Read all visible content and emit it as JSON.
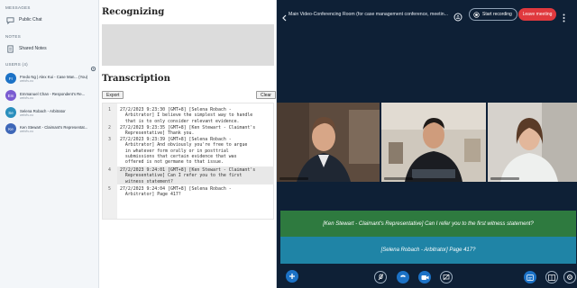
{
  "sidebar": {
    "messages_title": "MESSAGES",
    "public_chat": "Public Chat",
    "notes_title": "NOTES",
    "shared_notes": "Shared Notes",
    "users_title": "USERS (4)",
    "users": [
      {
        "initials": "Fr",
        "name": "Fredo Ng | Alex Kui - Case Man... (You)",
        "sub": "web/tv-no",
        "color": "#1c72c6"
      },
      {
        "initials": "Em",
        "name": "Emmanuel Chan - Respondent's Re...",
        "sub": "web/tv-no",
        "color": "#7a5bd1"
      },
      {
        "initials": "Se",
        "name": "Selena Robach - Arbitrator",
        "sub": "web/tv-no",
        "color": "#2a8fbd"
      },
      {
        "initials": "Ke",
        "name": "Ken Stewart - Claimant's Representat...",
        "sub": "web/tv-no",
        "color": "#3e67b8"
      }
    ]
  },
  "middle": {
    "recognizing_title": "Recognizing",
    "transcription_title": "Transcription",
    "export_label": "Export",
    "clear_label": "Clear",
    "lines": [
      {
        "num": "1",
        "text": "27/2/2023 9:23:30 [GMT+8] [Selena Robach -\n  Arbitrator] I believe the simplest way to handle\n  that is to only consider relevant evidence."
      },
      {
        "num": "2",
        "text": "27/2/2023 9:23:35 [GMT+8] [Ken Stewart - Claimant's\n  Representative] Thank you."
      },
      {
        "num": "3",
        "text": "27/2/2023 9:23:39 [GMT+8] [Selena Robach -\n  Arbitrator] And obviously you're free to argue\n  in whatever form orally or in posttrial\n  submissions that certain evidence that was\n  offered is not germane to that issue."
      },
      {
        "num": "4",
        "text": "27/2/2023 9:24:01 [GMT+8] [Ken Stewart - Claimant's\n  Representative] Can I refer you to the first\n  witness statement?"
      },
      {
        "num": "5",
        "text": "27/2/2023 9:24:04 [GMT+8] [Selena Robach -\n  Arbitrator] Page 417?"
      }
    ]
  },
  "meeting": {
    "title": "Main Video-Conferencing Room (for case management conference, meetin...",
    "start_recording": "Start recording",
    "leave_meeting": "Leave meeting",
    "captions": [
      {
        "text": "[Ken Stewart - Claimant's Representative] Can I refer you to the first witness statement?",
        "color": "#2e7a3f"
      },
      {
        "text": "[Selena Robach - Arbitrator] Page 417?",
        "color": "#1f84a6"
      }
    ]
  },
  "colors": {
    "accent": "#1c72c6",
    "leave": "#e0393e",
    "meeting_bg": "#0e2036"
  }
}
